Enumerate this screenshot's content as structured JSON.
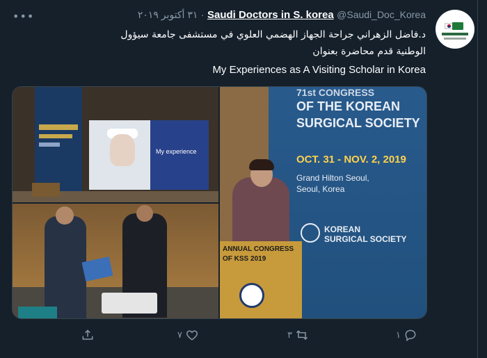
{
  "account": {
    "display_name": "Saudi Doctors in S. korea",
    "handle": "@Saudi_Doc_Korea",
    "separator": "·",
    "date": "٣١ أكتوبر ٢٠١٩"
  },
  "tweet": {
    "line1": "د.فاضل الزهراني جراحة الجهاز الهضمي العلوي في مستشفى جامعة سيؤول",
    "line2": "الوطنية  قدم محاضرة بعنوان",
    "line3": "My Experiences as A Visiting Scholar in Korea"
  },
  "media": {
    "slide_text": "My experience",
    "banner_line1": "71st CONGRESS",
    "banner_line2": "OF THE KOREAN",
    "banner_line3": "SURGICAL SOCIETY",
    "banner_dates": "OCT. 31 - NOV. 2, 2019",
    "banner_venue1": "Grand Hilton Seoul,",
    "banner_venue2": "Seoul, Korea",
    "banner_society1": "KOREAN",
    "banner_society2": "SURGICAL SOCIETY",
    "podium_line1": "ANNUAL CONGRESS",
    "podium_line2": "OF KSS 2019"
  },
  "actions": {
    "reply_count": "١",
    "retweet_count": "٣",
    "like_count": "٧"
  },
  "icons": {
    "more": "more-icon",
    "reply": "reply-icon",
    "retweet": "retweet-icon",
    "like": "heart-icon",
    "share": "share-icon"
  },
  "colors": {
    "background": "#15202b",
    "secondary_text": "#8899a6",
    "primary_text": "#ffffff"
  }
}
